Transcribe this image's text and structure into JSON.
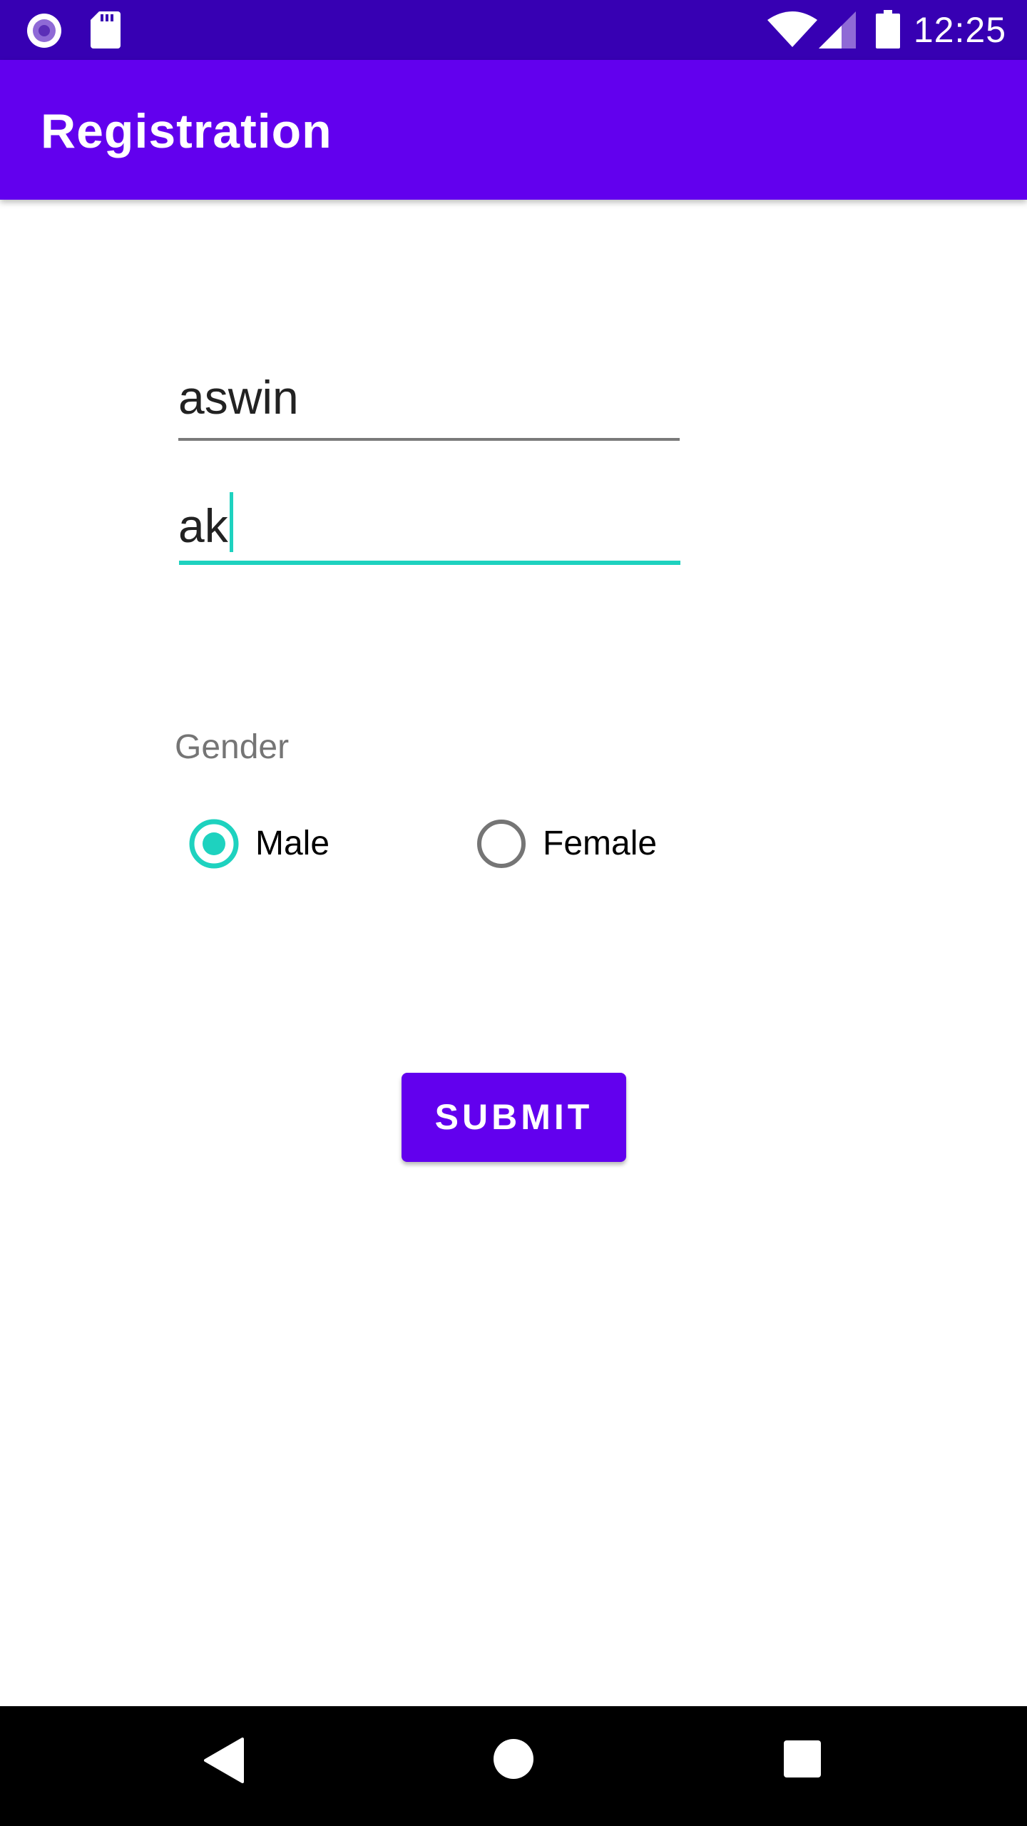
{
  "status_bar": {
    "time": "12:25",
    "left_icons": [
      "media-notification-icon",
      "sd-card-icon"
    ],
    "right_icons": [
      "wifi-icon",
      "signal-icon",
      "battery-icon"
    ],
    "background": "#3700b3"
  },
  "app_bar": {
    "title": "Registration",
    "background": "#6200ee"
  },
  "form": {
    "first_field": {
      "value": "aswin"
    },
    "second_field": {
      "value": "ak",
      "focused": true
    },
    "gender": {
      "label": "Gender",
      "options": [
        {
          "label": "Male",
          "selected": true
        },
        {
          "label": "Female",
          "selected": false
        }
      ]
    },
    "submit_label": "SUBMIT"
  },
  "colors": {
    "primary": "#6200ee",
    "primary_dark": "#3700b3",
    "accent": "#1ed2bf"
  },
  "nav_bar": {
    "icons": [
      "back-icon",
      "home-icon",
      "recents-icon"
    ]
  }
}
